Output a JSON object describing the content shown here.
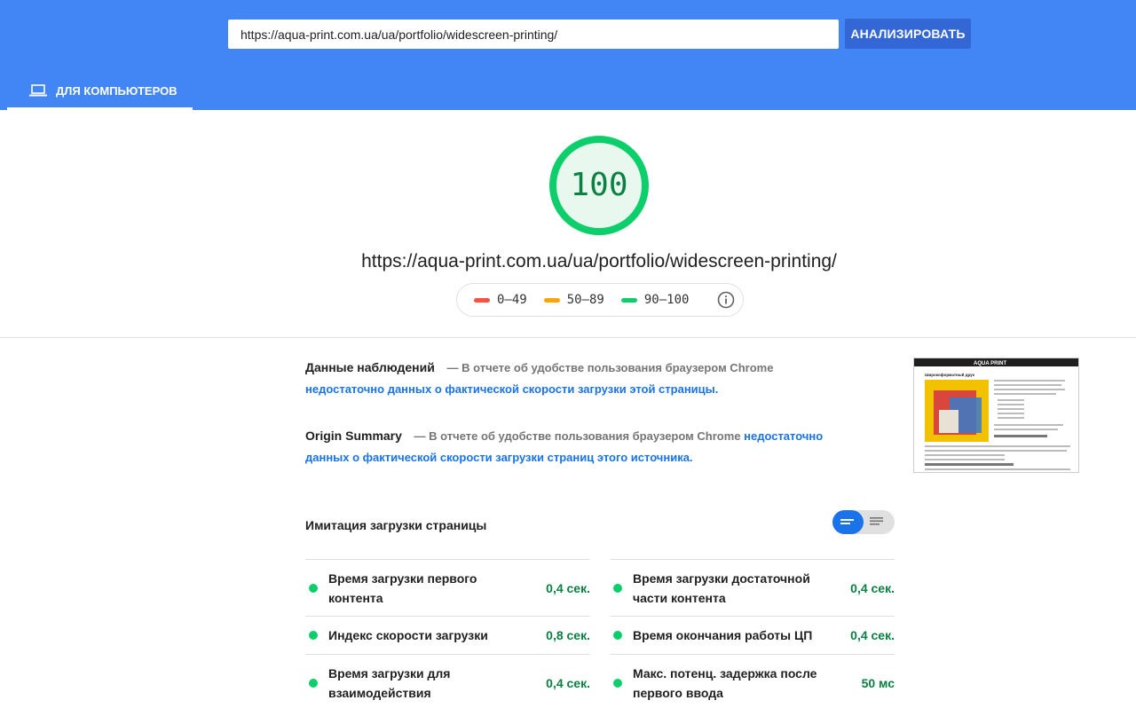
{
  "header": {
    "url_value": "https://aqua-print.com.ua/ua/portfolio/widescreen-printing/",
    "analyze_label": "АНАЛИЗИРОВАТЬ",
    "tab_label": "ДЛЯ КОМПЬЮТЕРОВ",
    "tab_icon": "laptop-icon"
  },
  "score": {
    "value": "100",
    "url": "https://aqua-print.com.ua/ua/portfolio/widescreen-printing/",
    "color": "#0cce6b"
  },
  "legend": {
    "items": [
      {
        "label": "0–49",
        "color": "#ff4e42"
      },
      {
        "label": "50–89",
        "color": "#ffa400"
      },
      {
        "label": "90–100",
        "color": "#0cce6b"
      }
    ],
    "info_icon": "info-icon"
  },
  "field_data": {
    "title": "Данные наблюдений",
    "text": "— В отчете об удобстве пользования браузером Chrome",
    "link": "недостаточно данных о фактической скорости загрузки этой страницы."
  },
  "origin_summary": {
    "title": "Origin Summary",
    "text": "— В отчете об удобстве пользования браузером Chrome",
    "link": "недостаточно данных о фактической скорости загрузки страниц этого источника."
  },
  "lab": {
    "title": "Имитация загрузки страницы",
    "metrics": [
      {
        "name": "Время загрузки первого контента",
        "value": "0,4 сек."
      },
      {
        "name": "Время загрузки достаточной части контента",
        "value": "0,4 сек."
      },
      {
        "name": "Индекс скорости загрузки",
        "value": "0,8 сек."
      },
      {
        "name": "Время окончания работы ЦП",
        "value": "0,4 сек."
      },
      {
        "name": "Время загрузки для взаимодействия",
        "value": "0,4 сек."
      },
      {
        "name": "Макс. потенц. задержка после первого ввода",
        "value": "50 мс"
      }
    ]
  },
  "thumbnail": {
    "brand": "AQUA PRINT",
    "heading": "Широкоформатный друк"
  }
}
